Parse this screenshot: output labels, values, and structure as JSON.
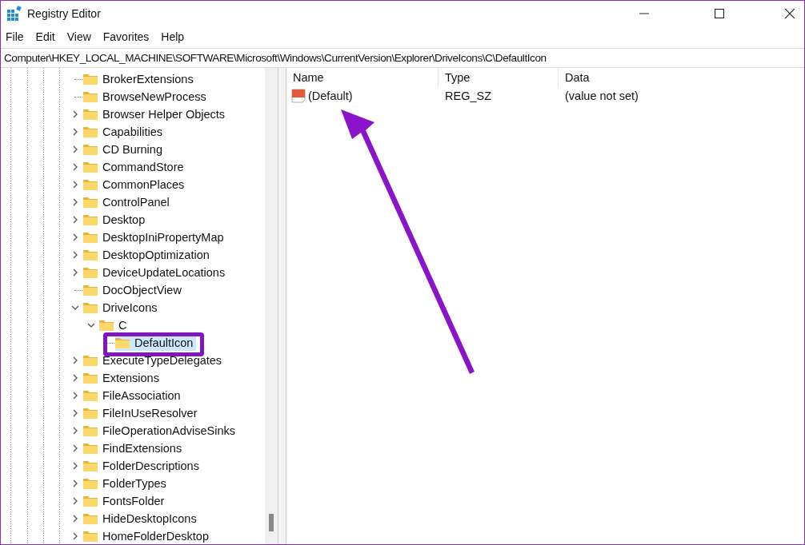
{
  "window": {
    "title": "Registry Editor"
  },
  "menu": [
    "File",
    "Edit",
    "View",
    "Favorites",
    "Help"
  ],
  "address": "Computer\\HKEY_LOCAL_MACHINE\\SOFTWARE\\Microsoft\\Windows\\CurrentVersion\\Explorer\\DriveIcons\\C\\DefaultIcon",
  "tree": [
    {
      "label": "BrokerExtensions",
      "has_children": false,
      "selected": false
    },
    {
      "label": "BrowseNewProcess",
      "has_children": false,
      "selected": false
    },
    {
      "label": "Browser Helper Objects",
      "has_children": true,
      "expanded": false,
      "selected": false
    },
    {
      "label": "Capabilities",
      "has_children": true,
      "expanded": false,
      "selected": false
    },
    {
      "label": "CD Burning",
      "has_children": true,
      "expanded": false,
      "selected": false
    },
    {
      "label": "CommandStore",
      "has_children": true,
      "expanded": false,
      "selected": false
    },
    {
      "label": "CommonPlaces",
      "has_children": true,
      "expanded": false,
      "selected": false
    },
    {
      "label": "ControlPanel",
      "has_children": true,
      "expanded": false,
      "selected": false
    },
    {
      "label": "Desktop",
      "has_children": true,
      "expanded": false,
      "selected": false
    },
    {
      "label": "DesktopIniPropertyMap",
      "has_children": true,
      "expanded": false,
      "selected": false
    },
    {
      "label": "DesktopOptimization",
      "has_children": true,
      "expanded": false,
      "selected": false
    },
    {
      "label": "DeviceUpdateLocations",
      "has_children": true,
      "expanded": false,
      "selected": false
    },
    {
      "label": "DocObjectView",
      "has_children": false,
      "selected": false
    },
    {
      "label": "DriveIcons",
      "has_children": true,
      "expanded": true,
      "selected": false,
      "children": [
        {
          "label": "C",
          "has_children": true,
          "expanded": true,
          "selected": false,
          "children": [
            {
              "label": "DefaultIcon",
              "has_children": false,
              "selected": true
            }
          ]
        }
      ]
    },
    {
      "label": "ExecuteTypeDelegates",
      "has_children": true,
      "expanded": false,
      "selected": false
    },
    {
      "label": "Extensions",
      "has_children": true,
      "expanded": false,
      "selected": false
    },
    {
      "label": "FileAssociation",
      "has_children": true,
      "expanded": false,
      "selected": false
    },
    {
      "label": "FileInUseResolver",
      "has_children": true,
      "expanded": false,
      "selected": false
    },
    {
      "label": "FileOperationAdviseSinks",
      "has_children": true,
      "expanded": false,
      "selected": false
    },
    {
      "label": "FindExtensions",
      "has_children": true,
      "expanded": false,
      "selected": false
    },
    {
      "label": "FolderDescriptions",
      "has_children": true,
      "expanded": false,
      "selected": false
    },
    {
      "label": "FolderTypes",
      "has_children": true,
      "expanded": false,
      "selected": false
    },
    {
      "label": "FontsFolder",
      "has_children": true,
      "expanded": false,
      "selected": false
    },
    {
      "label": "HideDesktopIcons",
      "has_children": true,
      "expanded": false,
      "selected": false
    },
    {
      "label": "HomeFolderDesktop",
      "has_children": true,
      "expanded": false,
      "selected": false
    }
  ],
  "values": {
    "columns": [
      "Name",
      "Type",
      "Data"
    ],
    "rows": [
      {
        "name": "(Default)",
        "type": "REG_SZ",
        "data": "(value not set)"
      }
    ]
  },
  "annotations": {
    "highlight_selected": true,
    "arrow_to_value": true
  }
}
